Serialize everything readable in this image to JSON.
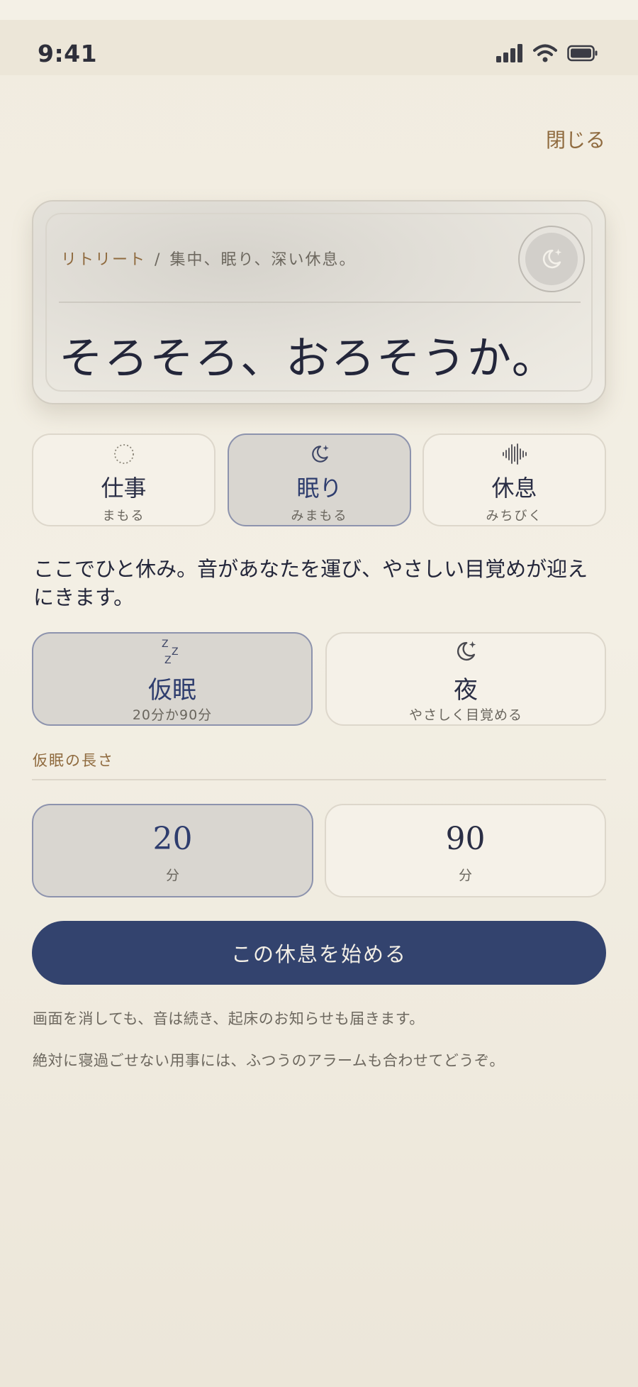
{
  "status_bar": {
    "time": "9:41",
    "icons": [
      "cellular-signal-icon",
      "wifi-icon",
      "battery-icon"
    ]
  },
  "header": {
    "close_label": "閉じる"
  },
  "hero": {
    "breadcrumb": "リトリート",
    "separator": "/",
    "subtitle": "集中、眠り、深い休息。",
    "title": "そろそろ、おろそうか。",
    "icon": "moon-sparkle-icon"
  },
  "modes": [
    {
      "title": "仕事",
      "subtitle": "まもる",
      "icon": "dotted-circle-icon",
      "selected": false
    },
    {
      "title": "眠り",
      "subtitle": "みまもる",
      "icon": "moon-sparkle-icon",
      "selected": true
    },
    {
      "title": "休息",
      "subtitle": "みちびく",
      "icon": "sound-wave-icon",
      "selected": false
    }
  ],
  "description": "ここでひと休み。音があなたを運び、やさしい目覚めが迎えにきます。",
  "sleep_types": [
    {
      "title": "仮眠",
      "subtitle": "20分か90分",
      "icon": "zzz-icon",
      "selected": true
    },
    {
      "title": "夜",
      "subtitle": "やさしく目覚める",
      "icon": "moon-sparkle-icon",
      "selected": false
    }
  ],
  "length_label": "仮眠の長さ",
  "durations": [
    {
      "value": "20",
      "unit": "分",
      "selected": true
    },
    {
      "value": "90",
      "unit": "分",
      "selected": false
    }
  ],
  "start_label": "この休息を始める",
  "notes": [
    "画面を消しても、音は続き、起床のお知らせも届きます。",
    "絶対に寝過ごせない用事には、ふつうのアラームも合わせてどうぞ。"
  ],
  "colors": {
    "accent": "#33436e",
    "gold": "#8f6a3e",
    "background": "#f1ece0"
  }
}
